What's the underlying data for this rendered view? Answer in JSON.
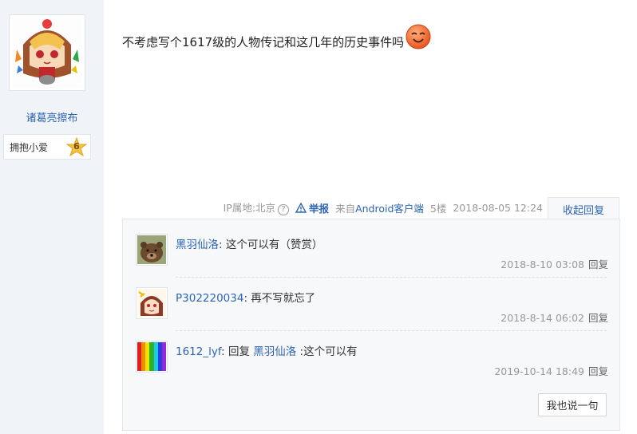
{
  "author": {
    "name": "诸葛亮擦布",
    "badge_label": "拥抱小爱",
    "badge_level": "6"
  },
  "post": {
    "text": "不考虑写个1617级的人物传记和这几年的历史事件吗",
    "emoji": "smiling-orange-emoji"
  },
  "tail": {
    "ip_location": "IP属地:北京",
    "ip_help": "?",
    "report": "举报",
    "source_prefix": "来自",
    "source_link": "Android客户端",
    "floor": "5楼",
    "timestamp": "2018-08-05 12:24",
    "collapse_label": "收起回复"
  },
  "replies": [
    {
      "user": "黑羽仙洛",
      "sep": ": ",
      "text": "这个可以有（赞赏）",
      "reply_to": "",
      "after": "",
      "time": "2018-8-10 03:08",
      "reply_label": "回复",
      "avatar": "bear-avatar"
    },
    {
      "user": "P302220034",
      "sep": ": ",
      "text": "再不写就忘了",
      "reply_to": "",
      "after": "",
      "time": "2018-8-14 06:02",
      "reply_label": "回复",
      "avatar": "anime-girl-avatar"
    },
    {
      "user": "1612_lyf",
      "sep": ": ",
      "text": "回复 ",
      "reply_to": "黑羽仙洛",
      "after": " :这个可以有",
      "time": "2019-10-14 18:49",
      "reply_label": "回复",
      "avatar": "rainbow-avatar"
    }
  ],
  "say_button": "我也说一句",
  "colors": {
    "link": "#2d64b3",
    "sidebar_bg": "#f0f3f8",
    "reply_bg": "#f7f8fa",
    "meta_text": "#999999"
  }
}
